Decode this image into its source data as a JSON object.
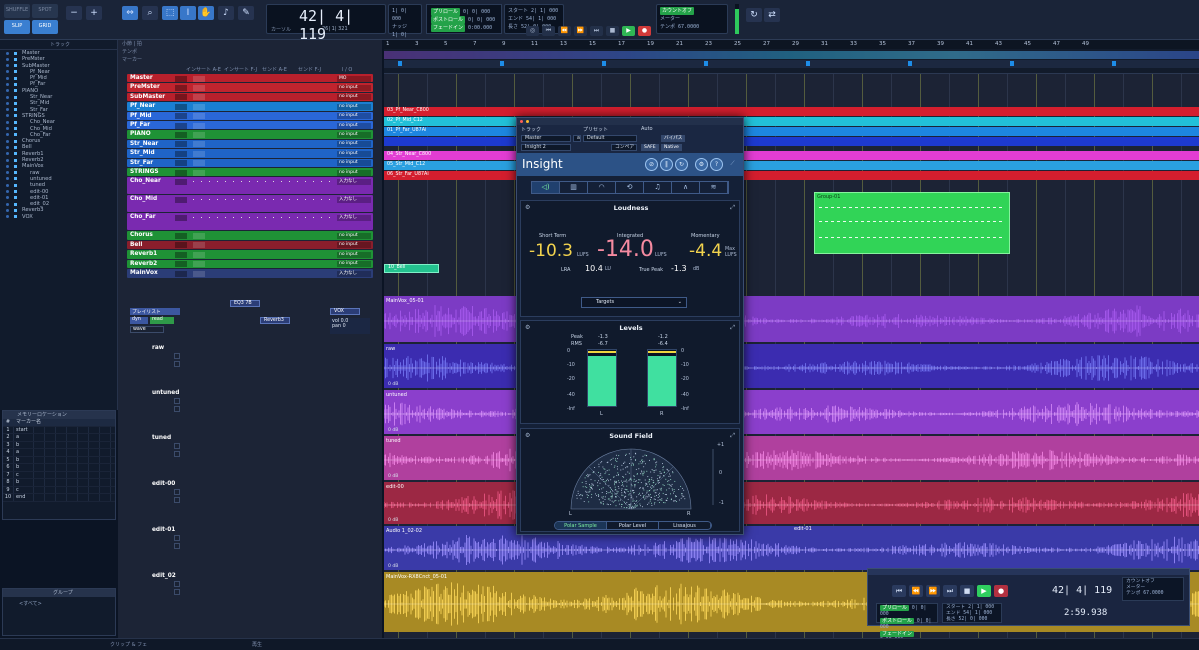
{
  "toolbar": {
    "edit_modes": [
      "SHUFFLE",
      "SPOT",
      "SLIP",
      "GRID"
    ],
    "main_counter": "42| 4| 119",
    "cursor_label": "カーソル",
    "cursor_value": "26| 1| 321",
    "nudge_label": "ナッジ",
    "nudge_value": "1| 0| 000",
    "grid_value": "1| 0| 000",
    "sel_start_label": "スタート",
    "sel_end_label": "エンド",
    "sel_length_label": "長さ",
    "sel_start": "2| 1| 000",
    "sel_end": "54| 1| 000",
    "sel_length": "52| 0| 000",
    "preroll_label": "プリロール",
    "postroll_label": "ポストロール",
    "fadein_label": "フェードイン",
    "preroll": "0| 0| 000",
    "postroll": "0| 0| 000",
    "fadein": "0:00.000",
    "count_off_label": "カウントオフ",
    "meter_label": "メーター",
    "tempo_label": "テンポ",
    "tempo_value": "67.0000",
    "meter_level": 0.85
  },
  "tracklist": {
    "title": "トラック",
    "items": [
      "Master",
      "PreMster",
      "SubMaster",
      "Pf_Near",
      "Pf_Mid",
      "Pf_Far",
      "PIANO",
      "Str_Near",
      "Str_Mid",
      "Str_Far",
      "STRINGS",
      "Cho_Near",
      "Cho_Mid",
      "Cho_Far",
      "Chorus",
      "Bell",
      "Reverb1",
      "Reverb2",
      "MainVox",
      "raw",
      "untuned",
      "tuned",
      "edit-00",
      "edit-01",
      "edit_02",
      "Reverb3",
      "VOX"
    ]
  },
  "memory_locations": {
    "title": "メモリーロケーション",
    "col_label": "マーカー名",
    "rows": [
      {
        "num": "1",
        "name": "start"
      },
      {
        "num": "2",
        "name": "a"
      },
      {
        "num": "3",
        "name": "b"
      },
      {
        "num": "4",
        "name": "a"
      },
      {
        "num": "5",
        "name": "b"
      },
      {
        "num": "6",
        "name": "b"
      },
      {
        "num": "7",
        "name": "c"
      },
      {
        "num": "8",
        "name": "b"
      },
      {
        "num": "9",
        "name": "c"
      },
      {
        "num": "10",
        "name": "end"
      }
    ]
  },
  "groups": {
    "title": "グループ",
    "items": [
      "<すべて>"
    ]
  },
  "mixer_headers": {
    "insert_ae": "インサート A-E",
    "insert_fj": "インサート F-J",
    "send_ae": "センド A-E",
    "send_fj": "センド F-J",
    "io": "I / O",
    "ruler_bars": "小節 | 拍",
    "ruler_tempo": "テンポ",
    "ruler_marker": "マーカー"
  },
  "tracks": [
    {
      "name": "Master",
      "color": "#b8202c",
      "io": "MO"
    },
    {
      "name": "PreMster",
      "color": "#c0242e",
      "io": "no input"
    },
    {
      "name": "SubMaster",
      "color": "#b8202c",
      "io": "no input"
    },
    {
      "name": "Pf_Near",
      "color": "#1a7fd2",
      "io": "no input"
    },
    {
      "name": "Pf_Mid",
      "color": "#2a67d8",
      "io": "no input"
    },
    {
      "name": "Pf_Far",
      "color": "#2a67d8",
      "io": "no input"
    },
    {
      "name": "PIANO",
      "color": "#1f9236",
      "io": "no input"
    },
    {
      "name": "Str_Near",
      "color": "#1f64c8",
      "io": "no input"
    },
    {
      "name": "Str_Mid",
      "color": "#1f64c8",
      "io": "no input"
    },
    {
      "name": "Str_Far",
      "color": "#1f64c8",
      "io": "no input"
    },
    {
      "name": "STRINGS",
      "color": "#1f9236",
      "io": "no input"
    },
    {
      "name": "Cho_Near",
      "color": "#7a2ab0",
      "io": "入力なし"
    },
    {
      "name": "Cho_Mid",
      "color": "#7a2ab0",
      "io": "入力なし"
    },
    {
      "name": "Cho_Far",
      "color": "#7a2ab0",
      "io": "入力なし"
    },
    {
      "name": "Chorus",
      "color": "#1f9236",
      "io": "no input"
    },
    {
      "name": "Bell",
      "color": "#8a1e2c",
      "io": "no input"
    },
    {
      "name": "Reverb1",
      "color": "#1f9236",
      "io": "no input"
    },
    {
      "name": "Reverb2",
      "color": "#1f9236",
      "io": "no input"
    },
    {
      "name": "MainVox",
      "color": "#2b3d77",
      "io": "入力なし"
    }
  ],
  "mainvox": {
    "insert": "EQ3 7B",
    "send": "Reverb3",
    "output": "VOX",
    "vol": "0.0",
    "pan": "0",
    "playlist": "プレイリスト",
    "dyn": "dyn",
    "mode": "read",
    "waveform": "wave"
  },
  "subtracks": [
    "raw",
    "untuned",
    "tuned",
    "edit-00",
    "edit-01",
    "edit_02"
  ],
  "ruler": {
    "bars": [
      "1",
      "3",
      "5",
      "7",
      "9",
      "11",
      "13",
      "15",
      "17",
      "19",
      "21",
      "23",
      "25",
      "27",
      "29",
      "31",
      "33",
      "35",
      "37",
      "39",
      "41",
      "43",
      "45",
      "47",
      "49"
    ]
  },
  "clips": {
    "top": [
      {
        "label": "03_Pf_Near_C800",
        "color": "#d41e2e"
      },
      {
        "label": "02_Pf_Mid_C12",
        "color": "#22c0d8"
      },
      {
        "label": "01_Pf_Far_U87Ai",
        "color": "#1d86e0"
      },
      {
        "label": "",
        "color": "#1d3ad0"
      },
      {
        "label": "04_Str_Near_C800",
        "color": "#e33dd3"
      },
      {
        "label": "05_Str_Mid_C12",
        "color": "#2aa0e0"
      },
      {
        "label": "06_Str_Far_U87Ai",
        "color": "#d41e2e"
      }
    ],
    "group": "Group-01",
    "small": "10_Bell",
    "wave": [
      {
        "label": "MainVox_05-01",
        "color": "#a055e8",
        "bg": "#7c3bc4",
        "db": ""
      },
      {
        "label": "raw",
        "color": "#6a6ae8",
        "bg": "#3b2cb0",
        "db": "0 dB"
      },
      {
        "label": "untuned",
        "color": "#c77cf0",
        "bg": "#8b3fcc",
        "db": "0 dB"
      },
      {
        "label": "tuned",
        "color": "#e87ad8",
        "bg": "#b0409e",
        "db": "0 dB"
      },
      {
        "label": "edit-00",
        "color": "#e0507a",
        "bg": "#9c2844",
        "db": "0 dB"
      },
      {
        "label": "Audio 1_02-02",
        "color": "#8a80f0",
        "bg": "#3a3aa8",
        "db": "0 dB"
      },
      {
        "label": "MainVox-RX8Cnct_05-01",
        "color": "#f0cc50",
        "bg": "#a88a24",
        "db": ""
      }
    ],
    "edit01_label": "edit-01"
  },
  "insight": {
    "track_label": "トラック",
    "preset_label": "プリセット",
    "auto_label": "Auto",
    "track_value": "Master",
    "track_code": "a",
    "preset_value": "Default",
    "plugin_instance": "Insight 2",
    "compare": "コンペア",
    "bypass": "バイパス",
    "safe": "SAFE",
    "native": "Native",
    "brand": "Insight",
    "loudness": {
      "title": "Loudness",
      "short_term_label": "Short Term",
      "integrated_label": "Integrated",
      "momentary_label": "Momentary",
      "short_term": "-10.3",
      "integrated": "-14.0",
      "momentary": "-4.4",
      "unit": "LUFS",
      "max_label": "Max",
      "lra_label": "LRA",
      "lra": "10.4",
      "lra_unit": "LU",
      "true_peak_label": "True Peak",
      "true_peak": "-1.3",
      "true_peak_unit": "dB",
      "targets": "Targets"
    },
    "levels": {
      "title": "Levels",
      "peak_label": "Peak",
      "rms_label": "RMS",
      "l_peak": "-1.3",
      "l_rms": "-6.7",
      "r_peak": "-1.2",
      "r_rms": "-6.4",
      "scale": [
        "0",
        "-10",
        "-20",
        "-40",
        "-Inf"
      ],
      "left": "L",
      "right": "R"
    },
    "soundfield": {
      "title": "Sound Field",
      "tabs": [
        "Polar Sample",
        "Polar Level",
        "Lissajous"
      ],
      "scale": [
        "+1",
        "0",
        "-1"
      ],
      "l": "L",
      "r": "R"
    }
  },
  "transport": {
    "main": "42| 4| 119",
    "sub": "2:59.938",
    "preroll_label": "プリロール",
    "postroll_label": "ポストロール",
    "fadein_label": "フェードイン",
    "preroll": "0| 0| 000",
    "postroll": "0| 0| 000",
    "fadein": "0:00.000",
    "start_label": "スタート",
    "end_label": "エンド",
    "length_label": "長さ",
    "start": "2| 1| 000",
    "end": "54| 1| 000",
    "length": "52| 0| 000",
    "count_off_label": "カウントオフ",
    "meter_label": "メーター",
    "tempo_label": "テンポ",
    "tempo": "67.0000"
  },
  "footer": {
    "clip_label": "クリップ & フェ",
    "playback_label": "再生"
  }
}
